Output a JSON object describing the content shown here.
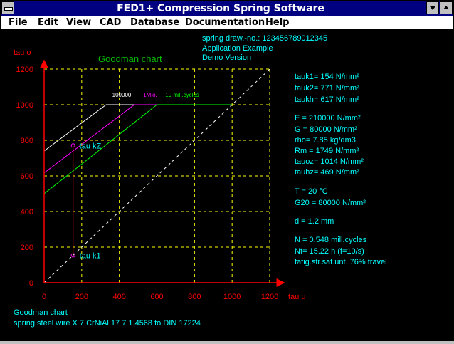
{
  "window": {
    "title": "FED1+    Compression Spring Software"
  },
  "menu": [
    {
      "label": "File"
    },
    {
      "label": "Edit"
    },
    {
      "label": "View"
    },
    {
      "label": "CAD"
    },
    {
      "label": "Database"
    },
    {
      "label": "Documentation"
    },
    {
      "label": "Help"
    }
  ],
  "header": {
    "line1": "spring   draw.-no.: 123456789012345",
    "line2": "Application Example",
    "line3": "Demo Version"
  },
  "chart_data": {
    "type": "line",
    "title": "Goodman chart",
    "xlabel": "tau u",
    "ylabel": "tau o",
    "xlim": [
      0,
      1200
    ],
    "ylim": [
      0,
      1200
    ],
    "x_ticks": [
      "0",
      "200",
      "400",
      "600",
      "800",
      "1000",
      "1200"
    ],
    "y_ticks": [
      "0",
      "200",
      "400",
      "600",
      "800",
      "1000",
      "1200"
    ],
    "grid": true,
    "grid_color": "#ffff00",
    "axis_color": "#ff0000",
    "series": [
      {
        "name": "100000",
        "color": "#ffffff",
        "points": [
          [
            0,
            740
          ],
          [
            330,
            1000
          ],
          [
            1000,
            1000
          ]
        ]
      },
      {
        "name": "1Mio.",
        "color": "#ff00ff",
        "points": [
          [
            0,
            617
          ],
          [
            480,
            1000
          ],
          [
            610,
            1000
          ]
        ]
      },
      {
        "name": "10 mill.cycles",
        "color": "#00ff00",
        "points": [
          [
            0,
            500
          ],
          [
            600,
            1000
          ],
          [
            1000,
            1000
          ]
        ]
      },
      {
        "name": "",
        "color": "#ffffff",
        "style": "dashed",
        "points": [
          [
            0,
            0
          ],
          [
            1200,
            1200
          ]
        ]
      }
    ],
    "markers": [
      {
        "label": "tau kZ",
        "x": 154,
        "y": 771,
        "color": "#ff00ff"
      },
      {
        "label": "tau k1",
        "x": 154,
        "y": 154,
        "color": "#ff00ff"
      }
    ]
  },
  "results": {
    "tauk1": "tauk1=  154 N/mm²",
    "tauk2": "tauk2=  771 N/mm²",
    "taukh": "taukh=  617 N/mm²",
    "E": "E = 210000 N/mm²",
    "G": "G =  80000 N/mm²",
    "rho": "rho=  7.85 kg/dm3",
    "Rm": "Rm =  1749 N/mm²",
    "tauoz": "tauoz= 1014 N/mm²",
    "tauhz": "tauhz=  469 N/mm²",
    "T": "T =  20 °C",
    "G20": "G20 = 80000 N/mm²",
    "d": "d  = 1.2 mm",
    "N": "N = 0.548 mill.cycles",
    "Nt": "Nt= 15.22 h   (f=10/s)",
    "fatig": "fatig.str.saf.unt. 76% travel"
  },
  "footer": {
    "line1": "Goodman chart",
    "line2": "spring steel wire X 7 CrNiAl 17 7   1.4568 to DIN 17224"
  },
  "colors": {
    "text": "#00ffff",
    "title": "#00c000",
    "axis": "#ff0000",
    "grid": "#ffff00",
    "titlebar": "#000080"
  }
}
